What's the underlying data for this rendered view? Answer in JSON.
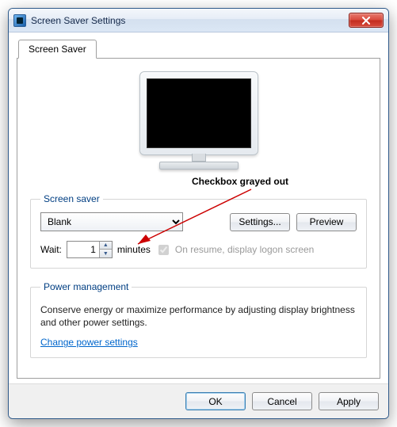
{
  "window": {
    "title": "Screen Saver Settings"
  },
  "tab": {
    "label": "Screen Saver"
  },
  "screensaver": {
    "legend": "Screen saver",
    "selected": "Blank",
    "settings_btn": "Settings...",
    "preview_btn": "Preview",
    "wait_label": "Wait:",
    "wait_value": "1",
    "wait_unit": "minutes",
    "resume_label": "On resume, display logon screen",
    "resume_checked": true,
    "resume_disabled": true
  },
  "power": {
    "legend": "Power management",
    "text": "Conserve energy or maximize performance by adjusting display brightness and other power settings.",
    "link": "Change power settings"
  },
  "buttons": {
    "ok": "OK",
    "cancel": "Cancel",
    "apply": "Apply"
  },
  "annotation": {
    "label": "Checkbox grayed out"
  }
}
